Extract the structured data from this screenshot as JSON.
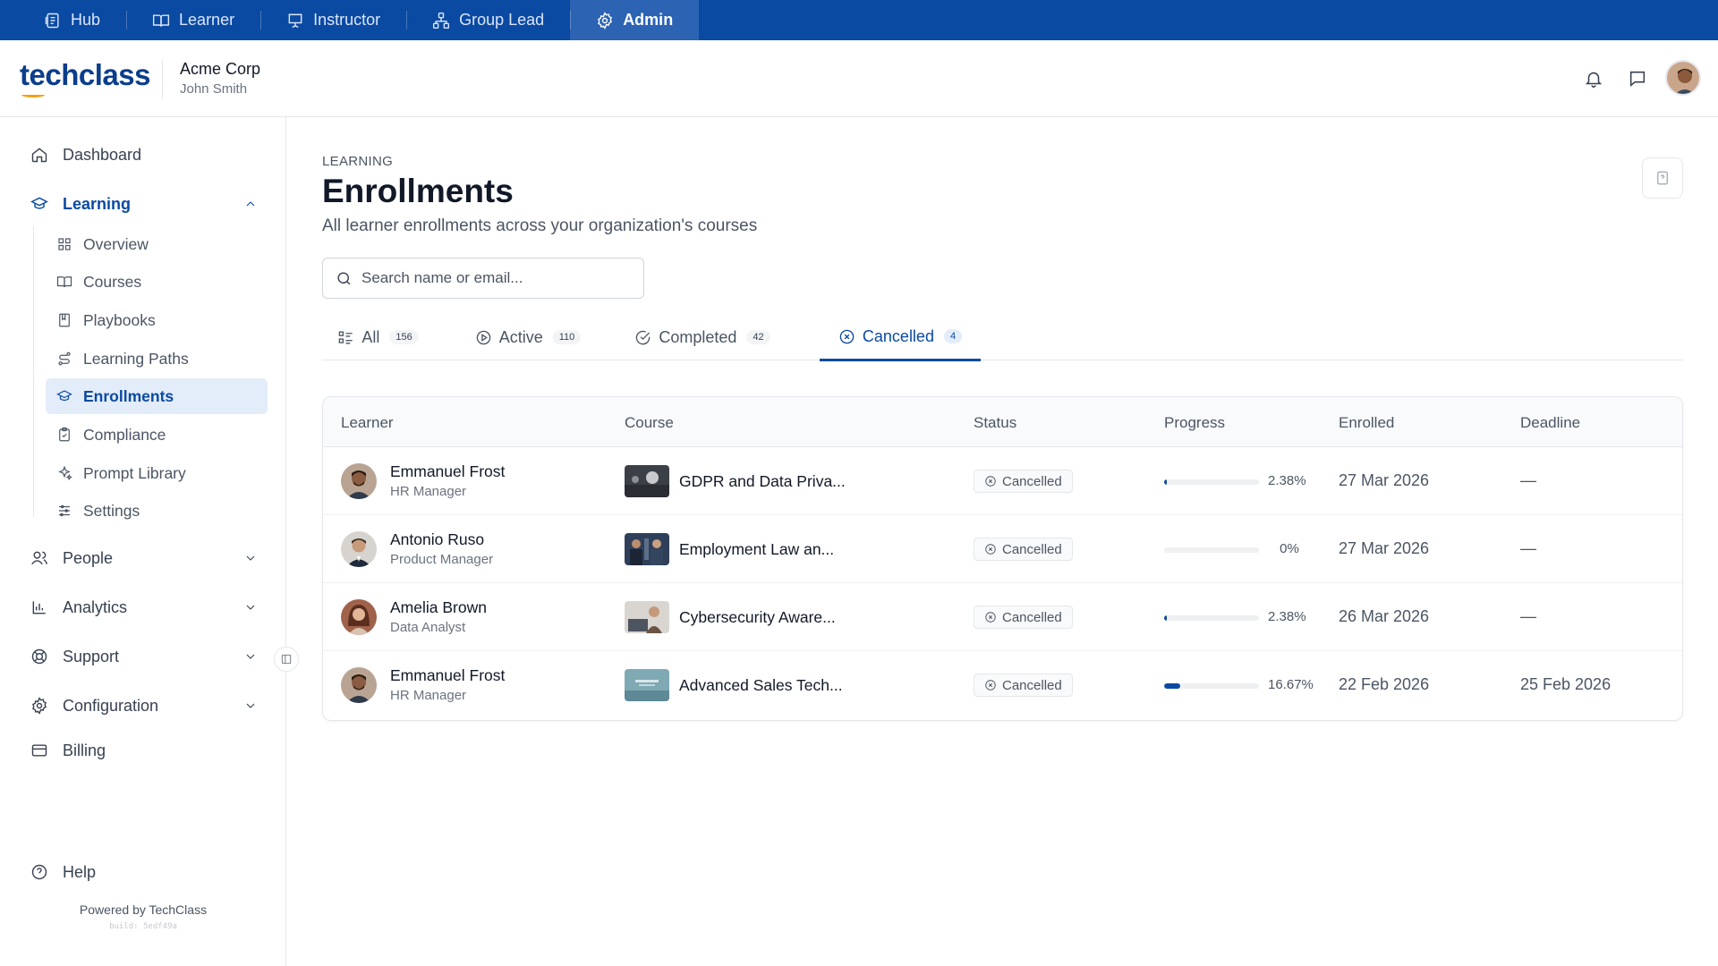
{
  "topbar": {
    "items": [
      {
        "label": "Hub",
        "icon": "hub-icon"
      },
      {
        "label": "Learner",
        "icon": "book-open-icon"
      },
      {
        "label": "Instructor",
        "icon": "presentation-icon"
      },
      {
        "label": "Group Lead",
        "icon": "org-chart-icon"
      },
      {
        "label": "Admin",
        "icon": "gear-icon",
        "active": true
      }
    ]
  },
  "header": {
    "logo": "techclass",
    "org_name": "Acme Corp",
    "user_name": "John Smith"
  },
  "sidebar": {
    "dashboard": "Dashboard",
    "learning": "Learning",
    "sub_items": [
      {
        "label": "Overview",
        "icon": "grid-icon"
      },
      {
        "label": "Courses",
        "icon": "book-icon"
      },
      {
        "label": "Playbooks",
        "icon": "notebook-icon"
      },
      {
        "label": "Learning Paths",
        "icon": "route-icon"
      },
      {
        "label": "Enrollments",
        "icon": "graduation-cap-icon",
        "active": true
      },
      {
        "label": "Compliance",
        "icon": "clipboard-check-icon"
      },
      {
        "label": "Prompt Library",
        "icon": "sparkles-icon"
      },
      {
        "label": "Settings",
        "icon": "sliders-icon"
      }
    ],
    "people": "People",
    "analytics": "Analytics",
    "support": "Support",
    "configuration": "Configuration",
    "billing": "Billing",
    "help": "Help",
    "powered_by": "Powered by TechClass",
    "build": "build: 5edf49a"
  },
  "main": {
    "eyebrow": "LEARNING",
    "title": "Enrollments",
    "subtitle": "All learner enrollments across your organization's courses",
    "search_placeholder": "Search name or email...",
    "tabs": [
      {
        "label": "All",
        "count": "156",
        "icon": "list-icon"
      },
      {
        "label": "Active",
        "count": "110",
        "icon": "play-circle-icon"
      },
      {
        "label": "Completed",
        "count": "42",
        "icon": "check-circle-icon"
      },
      {
        "label": "Cancelled",
        "count": "4",
        "icon": "x-circle-icon",
        "active": true
      }
    ],
    "columns": [
      "Learner",
      "Course",
      "Status",
      "Progress",
      "Enrolled",
      "Deadline"
    ],
    "rows": [
      {
        "name": "Emmanuel Frost",
        "role": "HR Manager",
        "course": "GDPR and Data Priva...",
        "status": "Cancelled",
        "progress_label": "2.38%",
        "progress": 2.38,
        "enrolled": "27 Mar 2026",
        "deadline": "—"
      },
      {
        "name": "Antonio Ruso",
        "role": "Product Manager",
        "course": "Employment Law an...",
        "status": "Cancelled",
        "progress_label": "0%",
        "progress": 0,
        "enrolled": "27 Mar 2026",
        "deadline": "—"
      },
      {
        "name": "Amelia Brown",
        "role": "Data Analyst",
        "course": "Cybersecurity Aware...",
        "status": "Cancelled",
        "progress_label": "2.38%",
        "progress": 2.38,
        "enrolled": "26 Mar 2026",
        "deadline": "—"
      },
      {
        "name": "Emmanuel Frost",
        "role": "HR Manager",
        "course": "Advanced Sales Tech...",
        "status": "Cancelled",
        "progress_label": "16.67%",
        "progress": 16.67,
        "enrolled": "22 Feb 2026",
        "deadline": "25 Feb 2026"
      }
    ]
  },
  "colors": {
    "primary": "#0b4aa2",
    "topbar": "#0b4aa2",
    "topbar_active": "#2c63b3",
    "active_bg": "#e3ecf9"
  }
}
